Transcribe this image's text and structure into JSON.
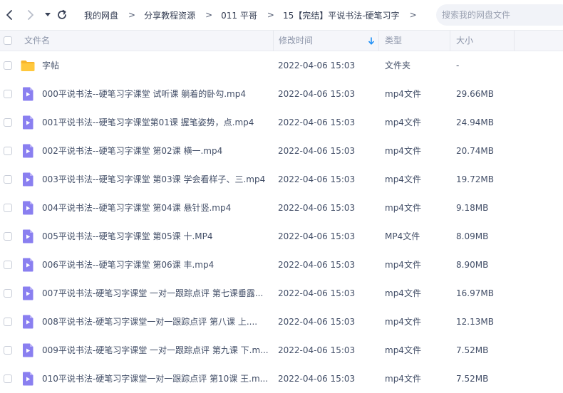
{
  "nav": {
    "back_icon": "chevron-left-icon",
    "forward_icon": "chevron-right-icon",
    "history_icon": "caret-down-icon",
    "refresh_icon": "refresh-icon"
  },
  "breadcrumb": [
    {
      "label": "我的网盘"
    },
    {
      "label": "分享教程资源"
    },
    {
      "label": "011 平哥"
    },
    {
      "label": "15【完结】平说书法-硬笔习字"
    }
  ],
  "breadcrumb_separator": ">",
  "search": {
    "placeholder": "搜索我的网盘文件"
  },
  "columns": {
    "name": "文件名",
    "modified": "修改时间",
    "type": "类型",
    "size": "大小"
  },
  "colors": {
    "folder": "#ffc83d",
    "video": "#8a7ff0",
    "sort_arrow": "#1f8ff5"
  },
  "files": [
    {
      "icon": "folder-icon",
      "name": "字帖",
      "modified": "2022-04-06 15:03",
      "type": "文件夹",
      "size": "-"
    },
    {
      "icon": "video-file-icon",
      "name": "000平说书法--硬笔习字课堂 试听课 躺着的卧勾.mp4",
      "modified": "2022-04-06 15:03",
      "type": "mp4文件",
      "size": "29.66MB"
    },
    {
      "icon": "video-file-icon",
      "name": "001平说书法--硬笔习字课堂第01课 握笔姿势，点.mp4",
      "modified": "2022-04-06 15:03",
      "type": "mp4文件",
      "size": "24.94MB"
    },
    {
      "icon": "video-file-icon",
      "name": "002平说书法--硬笔习字课堂 第02课 横一.mp4",
      "modified": "2022-04-06 15:03",
      "type": "mp4文件",
      "size": "20.74MB"
    },
    {
      "icon": "video-file-icon",
      "name": "003平说书法--硬笔习字课堂 第03课 学会看样子、三.mp4",
      "modified": "2022-04-06 15:03",
      "type": "mp4文件",
      "size": "19.72MB"
    },
    {
      "icon": "video-file-icon",
      "name": "004平说书法--硬笔习字课堂 第04课 悬针竖.mp4",
      "modified": "2022-04-06 15:03",
      "type": "mp4文件",
      "size": "9.18MB"
    },
    {
      "icon": "video-file-icon",
      "name": "005平说书法--硬笔习字课堂 第05课 十.MP4",
      "modified": "2022-04-06 15:03",
      "type": "MP4文件",
      "size": "8.09MB"
    },
    {
      "icon": "video-file-icon",
      "name": "006平说书法--硬笔习字课堂 第06课 丰.mp4",
      "modified": "2022-04-06 15:03",
      "type": "mp4文件",
      "size": "8.90MB"
    },
    {
      "icon": "video-file-icon",
      "name": "007平说书法-硬笔习字课堂 一对一跟踪点评 第七课垂露...",
      "modified": "2022-04-06 15:03",
      "type": "mp4文件",
      "size": "16.97MB"
    },
    {
      "icon": "video-file-icon",
      "name": "008平说书法-硬笔习字课堂一对一跟踪点评 第八课 上....",
      "modified": "2022-04-06 15:03",
      "type": "mp4文件",
      "size": "12.13MB"
    },
    {
      "icon": "video-file-icon",
      "name": "009平说书法-硬笔习字课堂 一对一跟踪点评 第九课 下.m...",
      "modified": "2022-04-06 15:03",
      "type": "mp4文件",
      "size": "7.52MB"
    },
    {
      "icon": "video-file-icon",
      "name": "010平说书法-硬笔习字课堂一对一跟踪点评 第10课 王.m...",
      "modified": "2022-04-06 15:03",
      "type": "mp4文件",
      "size": "7.52MB"
    }
  ]
}
